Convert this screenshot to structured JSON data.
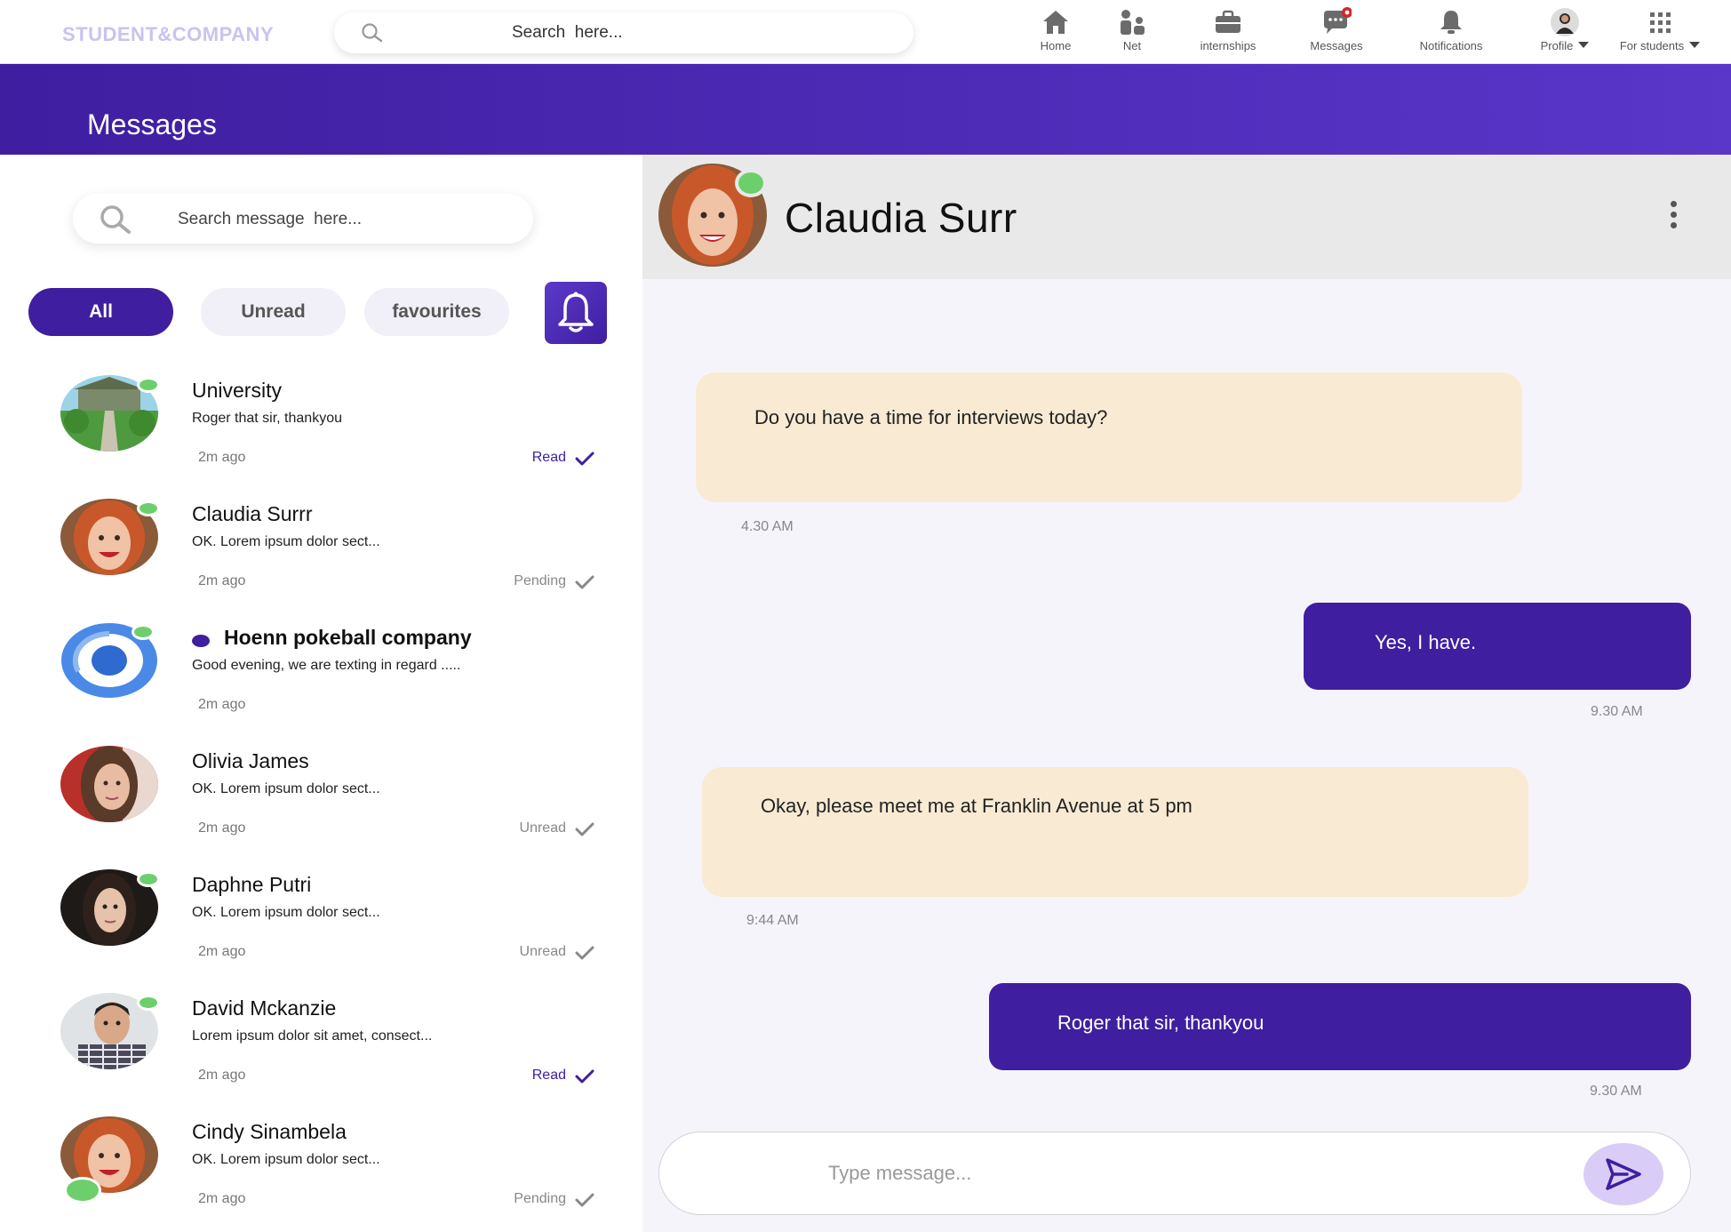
{
  "brand": "STUDENT&COMPANY",
  "top_search": {
    "placeholder": "Search  here..."
  },
  "nav": [
    {
      "label": "Home",
      "icon": "home-icon"
    },
    {
      "label": "Net",
      "icon": "network-icon"
    },
    {
      "label": "internships",
      "icon": "briefcase-icon"
    },
    {
      "label": "Messages",
      "icon": "chat-icon"
    },
    {
      "label": "Notifications",
      "icon": "bell-icon"
    },
    {
      "label": "Profile",
      "icon": "avatar"
    },
    {
      "label": "For students",
      "icon": "grid-icon"
    }
  ],
  "page_title": "Messages",
  "message_search": {
    "placeholder": "Search message  here..."
  },
  "filters": {
    "all": "All",
    "unread": "Unread",
    "favourites": "favourites"
  },
  "conversations": [
    {
      "name": "University",
      "preview": "Roger that sir, thankyou",
      "time": "2m ago",
      "status": "Read",
      "online": true,
      "unread_dot": false
    },
    {
      "name": "Claudia Surrr",
      "preview": "OK. Lorem ipsum dolor sect...",
      "time": "2m ago",
      "status": "Pending",
      "online": true,
      "unread_dot": false
    },
    {
      "name": "Hoenn pokeball company",
      "preview": "Good evening, we are texting in regard .....",
      "time": "2m ago",
      "status": "",
      "online": true,
      "unread_dot": true
    },
    {
      "name": "Olivia James",
      "preview": "OK. Lorem ipsum dolor sect...",
      "time": "2m ago",
      "status": "Unread",
      "online": false,
      "unread_dot": false
    },
    {
      "name": "Daphne Putri",
      "preview": "OK. Lorem ipsum dolor sect...",
      "time": "2m ago",
      "status": "Unread",
      "online": true,
      "unread_dot": false
    },
    {
      "name": "David Mckanzie",
      "preview": "Lorem ipsum dolor sit amet, consect...",
      "time": "2m ago",
      "status": "Read",
      "online": true,
      "unread_dot": false
    },
    {
      "name": "Cindy Sinambela",
      "preview": "OK. Lorem ipsum dolor sect...",
      "time": "2m ago",
      "status": "Pending",
      "online": true,
      "unread_dot": false
    }
  ],
  "chat": {
    "contact_name": "Claudia Surr",
    "messages": [
      {
        "direction": "in",
        "text": "Do you have a time for interviews today?",
        "time": "4.30 AM"
      },
      {
        "direction": "out",
        "text": "Yes, I have.",
        "time": "9.30 AM"
      },
      {
        "direction": "in",
        "text": "Okay, please meet me at Franklin Avenue at 5 pm",
        "time": "9:44 AM"
      },
      {
        "direction": "out",
        "text": "Roger that sir, thankyou",
        "time": "9.30 AM"
      }
    ],
    "composer_placeholder": "Type message..."
  },
  "colors": {
    "primary": "#3f1ea0",
    "incoming_bubble": "#f9ebd3",
    "online": "#6ccf6c",
    "chat_bg": "#f6f4fb"
  }
}
